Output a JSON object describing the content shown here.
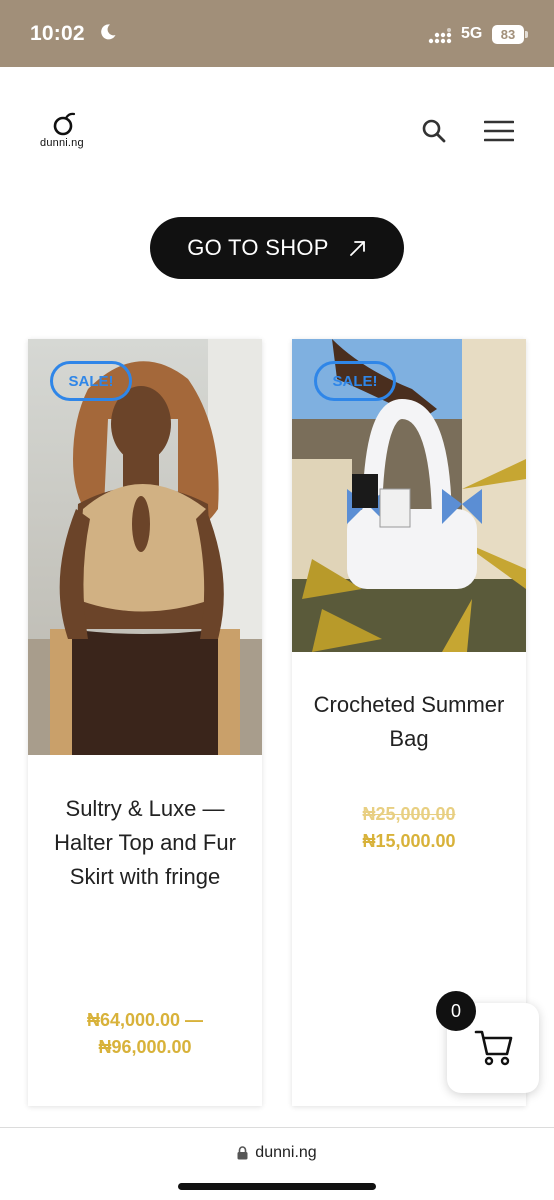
{
  "status_bar": {
    "time": "10:02",
    "network": "5G",
    "battery": "83"
  },
  "header": {
    "logo_text": "dunni.ng"
  },
  "shop_button": {
    "label": "GO TO SHOP"
  },
  "products": [
    {
      "badge": "SALE!",
      "title": "Sultry & Luxe — Halter Top and Fur Skirt with fringe",
      "price_range": "₦64,000.00 — ₦96,000.00"
    },
    {
      "badge": "SALE!",
      "title": "Crocheted Summer Bag",
      "price_old": "₦25,000.00",
      "price_new": "₦15,000.00"
    }
  ],
  "cart": {
    "count": "0"
  },
  "url_bar": {
    "domain": "dunni.ng"
  },
  "colors": {
    "status_bar": "#a18f79",
    "accent_price": "#d8b23a",
    "badge_blue": "#2f86e8",
    "button_dark": "#111111"
  }
}
